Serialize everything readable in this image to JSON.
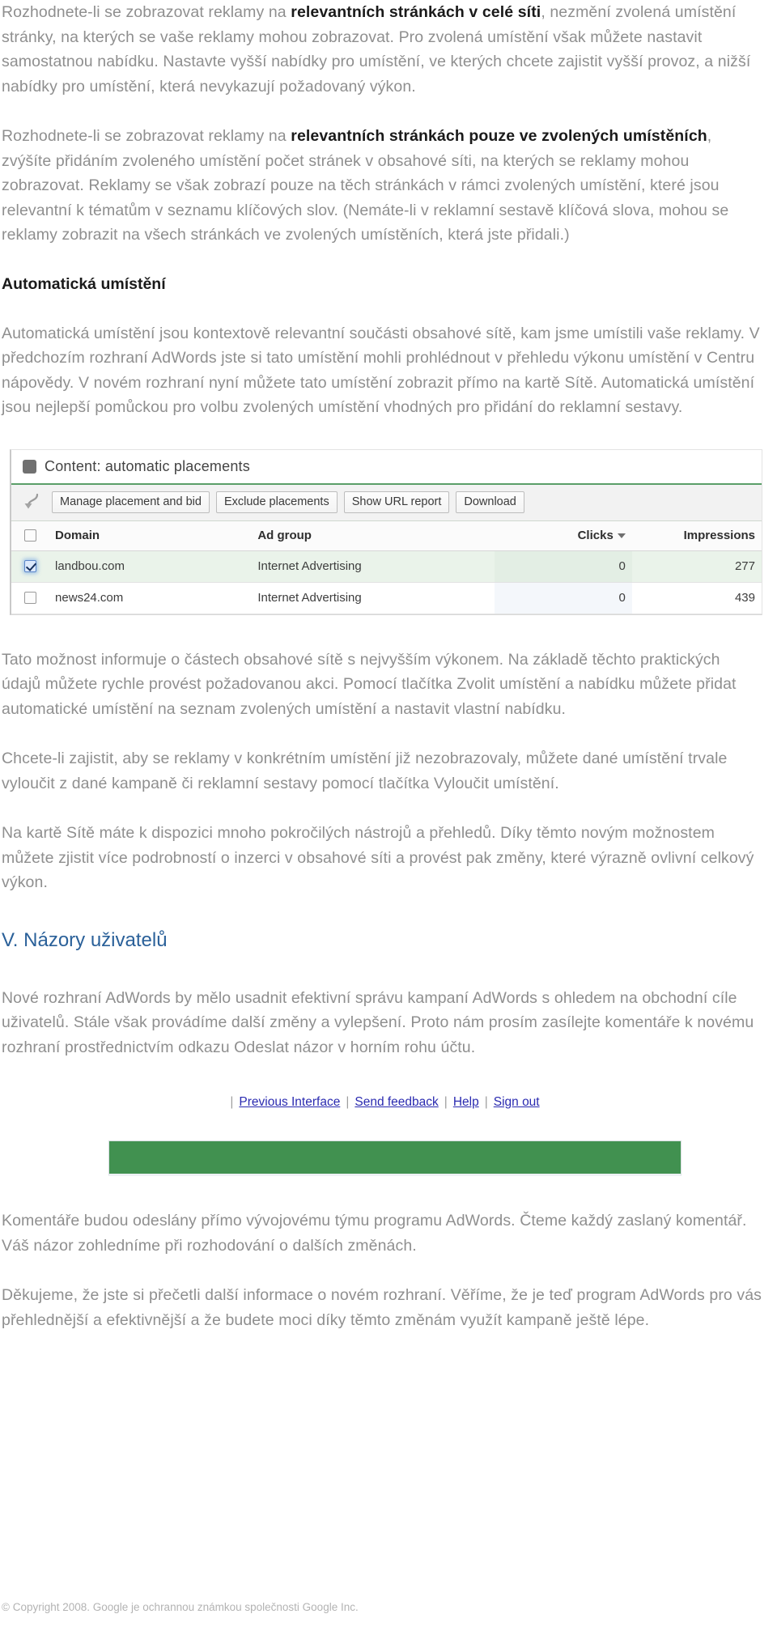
{
  "document": {
    "paragraphs": {
      "p1_pre": "Rozhodnete-li se zobrazovat reklamy na ",
      "p1_bold": "relevantních stránkách v celé síti",
      "p1_post": ", nezmění zvolená umístění stránky, na kterých se vaše reklamy mohou zobrazovat. Pro zvolená umístění však můžete nastavit samostatnou nabídku. Nastavte vyšší nabídky pro umístění, ve kterých chcete zajistit vyšší provoz, a nižší nabídky pro umístění, která nevykazují požadovaný výkon.",
      "p2_pre": "Rozhodnete-li se zobrazovat reklamy na ",
      "p2_bold": "relevantních stránkách pouze ve zvolených umístěních",
      "p2_post": ", zvýšíte přidáním zvoleného umístění počet stránek v obsahové síti, na kterých se reklamy mohou zobrazovat. Reklamy se však zobrazí pouze na těch stránkách v rámci zvolených umístění, které jsou relevantní k tématům v seznamu klíčových slov. (Nemáte-li v reklamní sestavě klíčová slova, mohou se reklamy zobrazit na všech stránkách ve zvolených umístěních, která jste přidali.)",
      "heading_auto_placements": "Automatická umístění",
      "p3": "Automatická umístění jsou kontextově relevantní součásti obsahové sítě, kam jsme umístili vaše reklamy. V předchozím rozhraní AdWords jste si tato umístění mohli prohlédnout v přehledu výkonu umístění v Centru nápovědy. V novém rozhraní nyní můžete tato umístění zobrazit přímo na kartě Sítě. Automatická umístění jsou nejlepší pomůckou pro volbu zvolených umístění vhodných pro přidání do reklamní sestavy.",
      "p4": "Tato možnost informuje o částech obsahové sítě s nejvyšším výkonem. Na základě těchto praktických údajů můžete rychle provést požadovanou akci. Pomocí tlačítka Zvolit umístění a nabídku můžete přidat automatické umístění na seznam zvolených umístění a nastavit vlastní nabídku.",
      "p5": "Chcete-li zajistit, aby se reklamy v konkrétním umístění již nezobrazovaly, můžete dané umístění trvale vyloučit z dané kampaně či reklamní sestavy pomocí tlačítka Vyloučit umístění.",
      "p6": "Na kartě Sítě máte k dispozici mnoho pokročilých nástrojů a přehledů. Díky těmto novým možnostem můžete zjistit více podrobností o inzerci v obsahové síti a provést pak změny, které výrazně ovlivní celkový výkon.",
      "heading_section_v": "V. Názory uživatelů",
      "p7": "Nové rozhraní AdWords by mělo usadnit efektivní správu kampaní AdWords s ohledem na obchodní cíle uživatelů. Stále však provádíme další změny a vylepšení. Proto nám prosím zasílejte komentáře k novému rozhraní prostřednictvím odkazu Odeslat názor v horním rohu účtu.",
      "p8": "Komentáře budou odeslány přímo vývojovému týmu programu AdWords. Čteme každý zaslaný komentář. Váš názor zohledníme při rozhodování o dalších změnách.",
      "p9": "Děkujeme, že jste si přečetli další informace o novém rozhraní. Věříme, že je teď program AdWords pro vás přehlednější a efektivnější a že budete moci díky těmto změnám využít kampaně ještě lépe."
    },
    "footer": {
      "copyright": "© Copyright 2008. Google je ochrannou známkou společnosti Google Inc."
    }
  },
  "screenshot": {
    "panel_title": "Content: automatic placements",
    "panel_title_icon": "gray-square-icon",
    "toolbar": {
      "back_arrow_icon": "curved-back-arrow-icon",
      "buttons": [
        "Manage placement and bid",
        "Exclude placements",
        "Show URL report",
        "Download"
      ]
    },
    "table": {
      "columns": [
        "",
        "Domain",
        "Ad group",
        "Clicks",
        "Impressions"
      ],
      "sorted_column": "Clicks",
      "sort_direction": "descending",
      "sort_caret": "▼",
      "rows": [
        {
          "checked": true,
          "domain": "landbou.com",
          "ad_group": "Internet Advertising",
          "clicks": "0",
          "impressions": "277"
        },
        {
          "checked": false,
          "domain": "news24.com",
          "ad_group": "Internet Advertising",
          "clicks": "0",
          "impressions": "439"
        }
      ]
    }
  },
  "linkbar": {
    "links": [
      "Previous Interface",
      "Send feedback",
      "Help",
      "Sign out"
    ],
    "separator": "|"
  },
  "colors": {
    "body_text": "#8f8f8f",
    "bold_text": "#1a1a1a",
    "section_heading": "#2a6099",
    "link": "#2a2ab0",
    "green_bar": "#419150",
    "green_divider": "#5a9e68",
    "selected_row": "#eaf3ea"
  }
}
